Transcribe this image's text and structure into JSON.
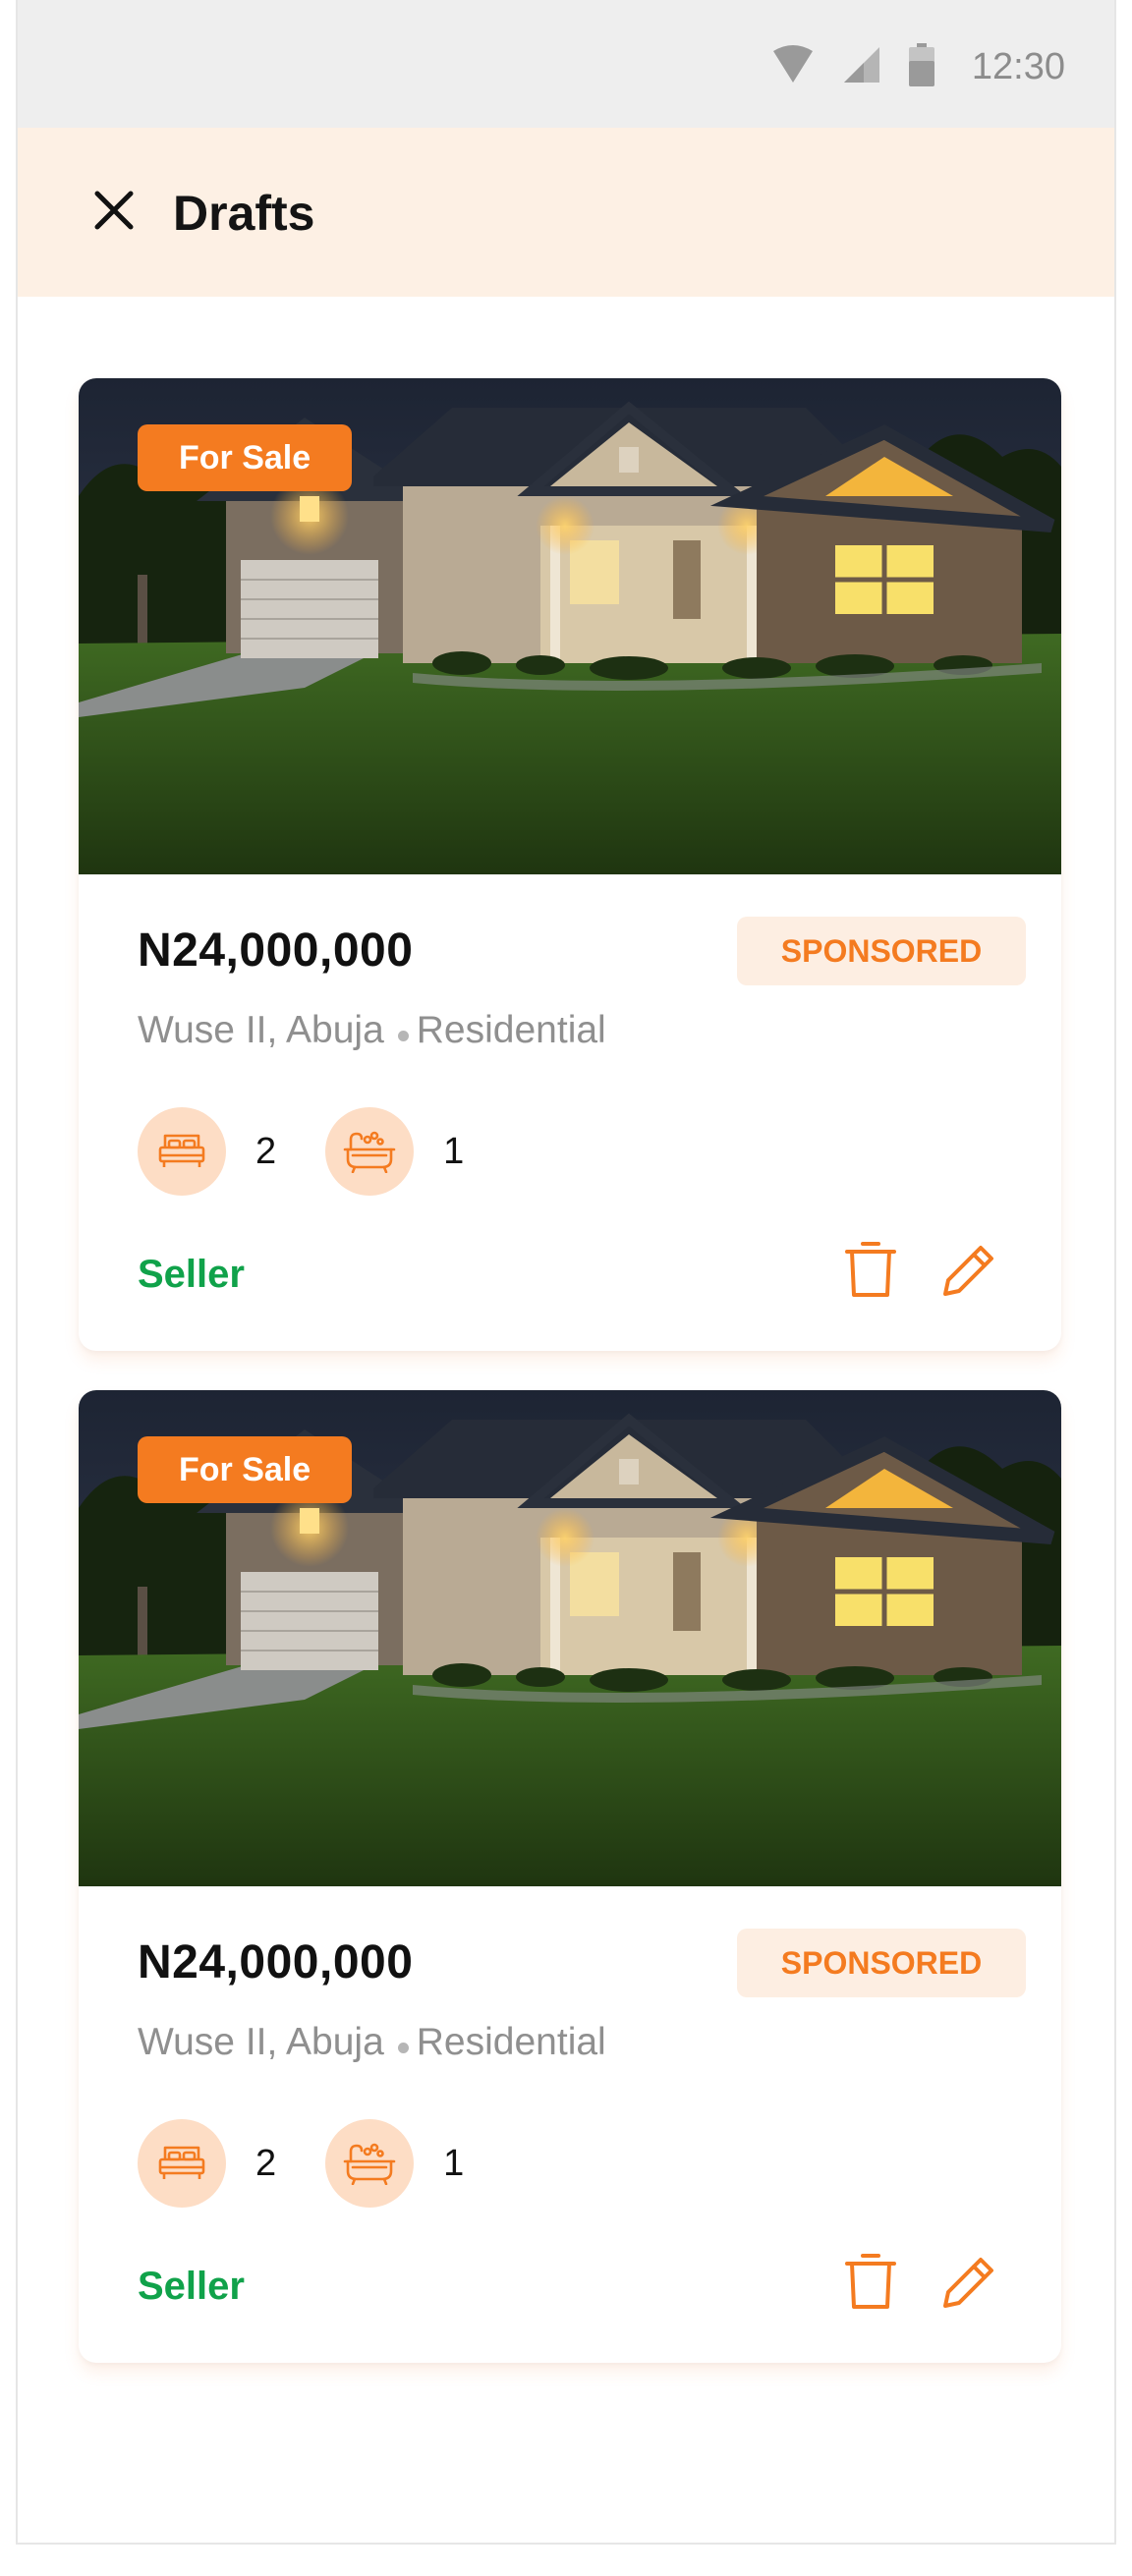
{
  "status_bar": {
    "time": "12:30"
  },
  "app_bar": {
    "title": "Drafts",
    "close_icon": "close-icon"
  },
  "colors": {
    "accent": "#f47b20",
    "accent_light": "#fdeee2",
    "header_bg": "#fdf0e4",
    "seller_green": "#10a24a"
  },
  "listings": [
    {
      "badge": "For Sale",
      "price": "N24,000,000",
      "tag": "SPONSORED",
      "location": "Wuse II, Abuja",
      "category": "Residential",
      "bedrooms": "2",
      "bathrooms": "1",
      "role": "Seller",
      "image": "house-at-dusk"
    },
    {
      "badge": "For Sale",
      "price": "N24,000,000",
      "tag": "SPONSORED",
      "location": "Wuse II, Abuja",
      "category": "Residential",
      "bedrooms": "2",
      "bathrooms": "1",
      "role": "Seller",
      "image": "house-at-dusk"
    }
  ]
}
